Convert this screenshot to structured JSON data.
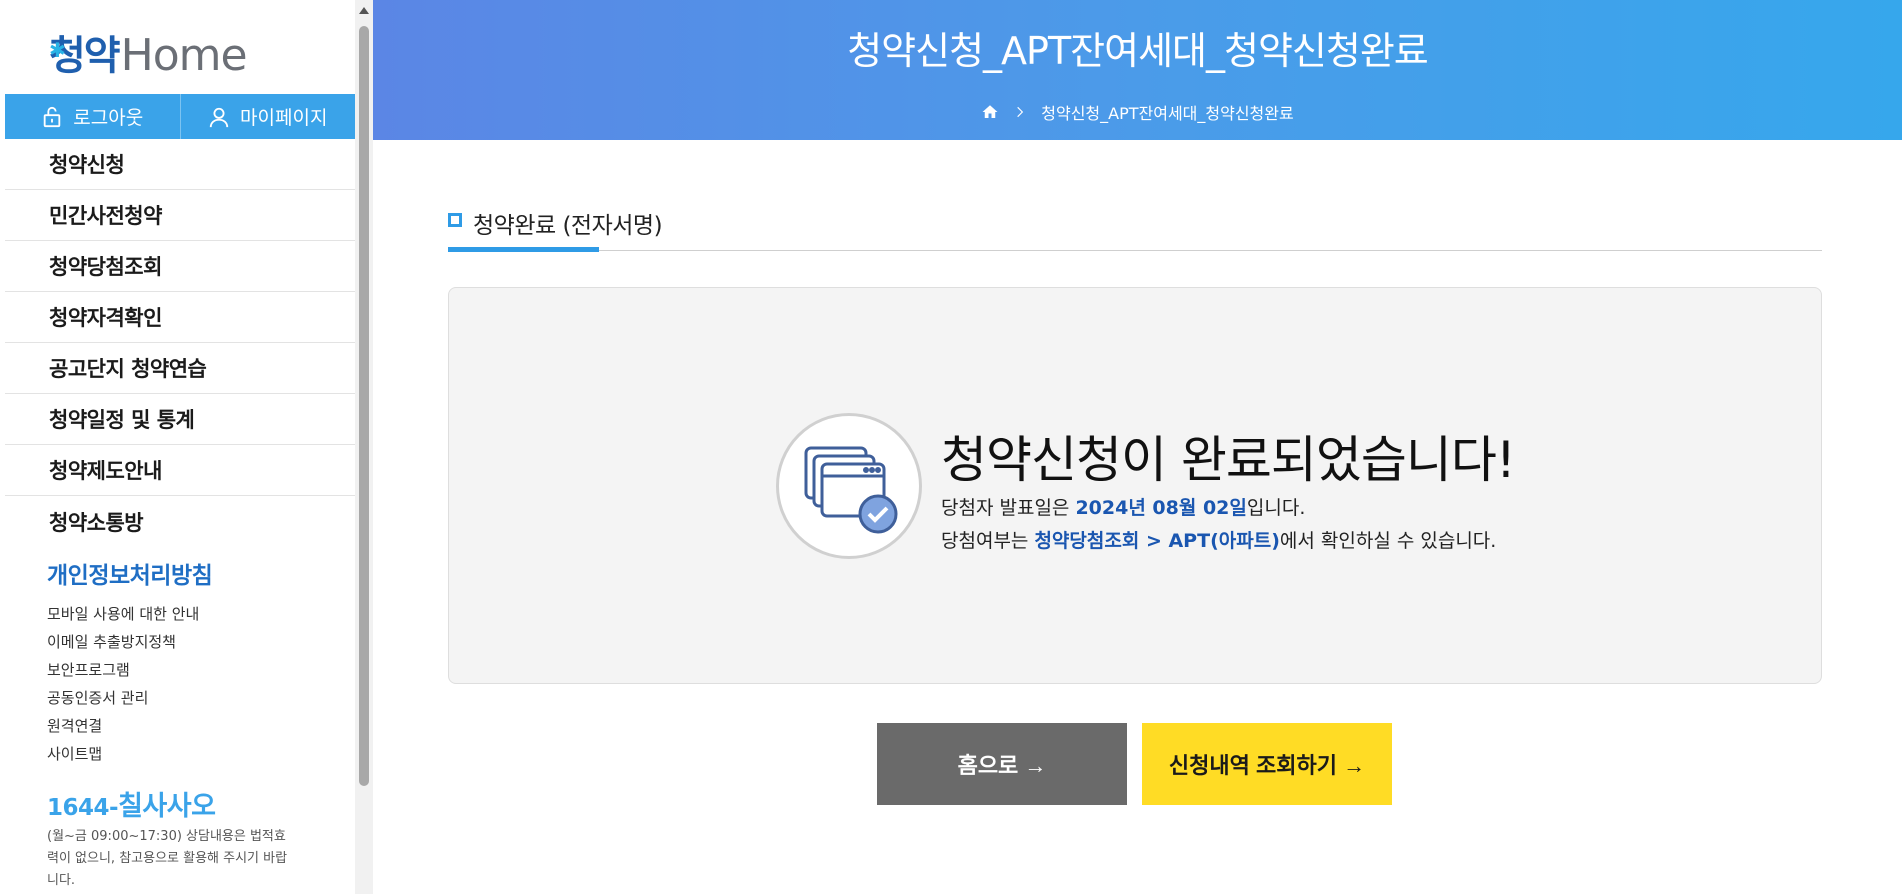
{
  "sidebar": {
    "logo_kr": "청약",
    "logo_en": "Home",
    "auth": {
      "logout": "로그아웃",
      "mypage": "마이페이지"
    },
    "menu": [
      "청약신청",
      "민간사전청약",
      "청약당첨조회",
      "청약자격확인",
      "공고단지 청약연습",
      "청약일정 및 통계",
      "청약제도안내",
      "청약소통방"
    ],
    "policy_title": "개인정보처리방침",
    "policy_links": [
      "모바일 사용에 대한 안내",
      "이메일 추출방지정책",
      "보안프로그램",
      "공동인증서 관리",
      "원격연결",
      "사이트맵"
    ],
    "phone_prefix": "1644-",
    "phone_word": "칠사사오",
    "phone_note": "(월~금 09:00~17:30) 상담내용은 법적효력이 없으니, 참고용으로 활용해 주시기 바랍니다."
  },
  "header": {
    "title": "청약신청_APT잔여세대_청약신청완료",
    "breadcrumb": "청약신청_APT잔여세대_청약신청완료"
  },
  "main": {
    "section_title": "청약완료 (전자서명)",
    "result_title": "청약신청이 완료되었습니다!",
    "line1_pre": "당첨자 발표일은 ",
    "line1_date": "2024년 08월 02일",
    "line1_post": "입니다.",
    "line2_pre": "당첨여부는 ",
    "line2_link": "청약당첨조회 > APT(아파트)",
    "line2_post": "에서 확인하실 수 있습니다.",
    "btn_home": "홈으로 →",
    "btn_history": "신청내역 조회하기 →"
  },
  "colors": {
    "accent": "#3aa3e9",
    "banner_start": "#5b86e5",
    "banner_end": "#36a7ec",
    "highlight": "#1a56b0",
    "btn_home": "#6a6a6a",
    "btn_history": "#ffdc25"
  }
}
